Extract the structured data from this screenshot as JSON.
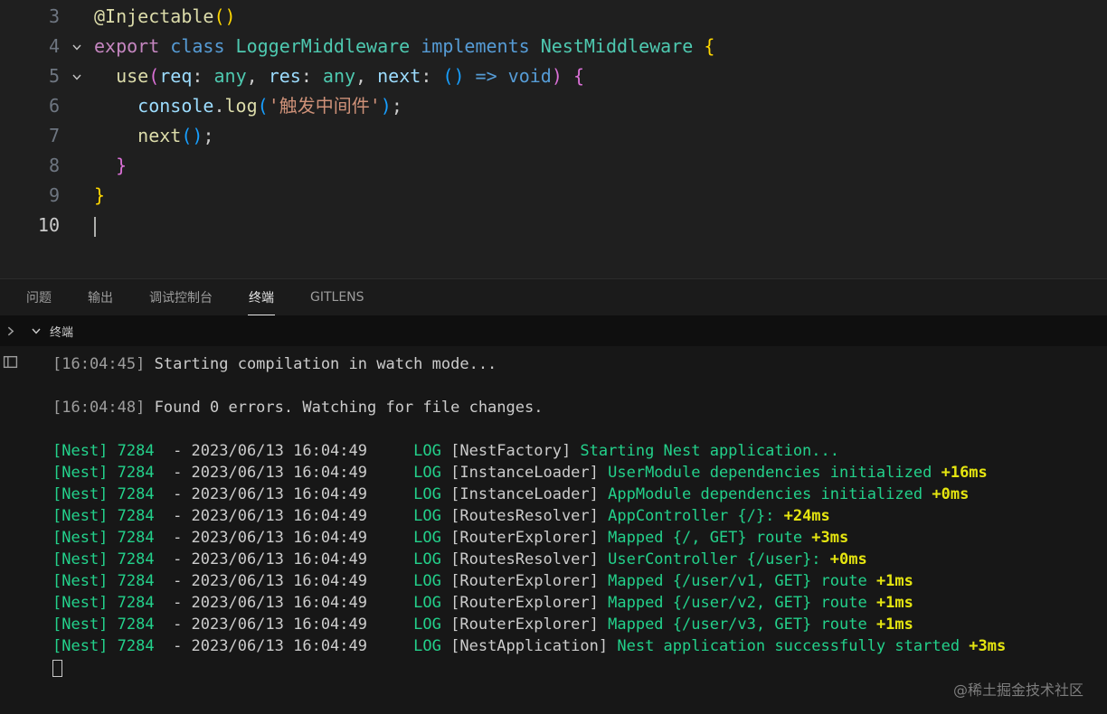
{
  "palette": {
    "fg": "#cccccc",
    "lineNumber": "#6e7681",
    "kwPurple": "#c586c0",
    "kwBlue": "#569cd6",
    "type": "#4ec9b0",
    "func": "#dcdcaa",
    "variable": "#9cdcfe",
    "string": "#ce9178",
    "br1": "#ffd700",
    "br2": "#da70d6",
    "br3": "#179fff",
    "tGreen": "#23d18b",
    "tYellow": "#e5e510",
    "tFg": "#cccccc",
    "tDim": "#9d9d9d"
  },
  "editor": {
    "lines": [
      {
        "num": "3",
        "fold": false,
        "segments": [
          [
            "@Injectable",
            "func"
          ],
          [
            "()",
            "br1"
          ]
        ]
      },
      {
        "num": "4",
        "fold": true,
        "segments": [
          [
            "export ",
            "kwPurple"
          ],
          [
            "class ",
            "kwBlue"
          ],
          [
            "LoggerMiddleware ",
            "type"
          ],
          [
            "implements ",
            "kwBlue"
          ],
          [
            "NestMiddleware ",
            "type"
          ],
          [
            "{",
            "br1"
          ]
        ]
      },
      {
        "num": "5",
        "fold": true,
        "segments": [
          [
            "  ",
            "fg"
          ],
          [
            "use",
            "func"
          ],
          [
            "(",
            "br2"
          ],
          [
            "req",
            "variable"
          ],
          [
            ": ",
            "fg"
          ],
          [
            "any",
            "type"
          ],
          [
            ", ",
            "fg"
          ],
          [
            "res",
            "variable"
          ],
          [
            ": ",
            "fg"
          ],
          [
            "any",
            "type"
          ],
          [
            ", ",
            "fg"
          ],
          [
            "next",
            "variable"
          ],
          [
            ": ",
            "fg"
          ],
          [
            "()",
            "br3"
          ],
          [
            " ",
            "fg"
          ],
          [
            "=> ",
            "kwBlue"
          ],
          [
            "void",
            "kwBlue"
          ],
          [
            ")",
            "br2"
          ],
          [
            " ",
            "fg"
          ],
          [
            "{",
            "br2"
          ]
        ]
      },
      {
        "num": "6",
        "fold": false,
        "segments": [
          [
            "    ",
            "fg"
          ],
          [
            "console",
            "variable"
          ],
          [
            ".",
            "fg"
          ],
          [
            "log",
            "func"
          ],
          [
            "(",
            "br3"
          ],
          [
            "'触发中间件'",
            "string"
          ],
          [
            ")",
            "br3"
          ],
          [
            ";",
            "fg"
          ]
        ]
      },
      {
        "num": "7",
        "fold": false,
        "segments": [
          [
            "    ",
            "fg"
          ],
          [
            "next",
            "func"
          ],
          [
            "()",
            "br3"
          ],
          [
            ";",
            "fg"
          ]
        ]
      },
      {
        "num": "8",
        "fold": false,
        "segments": [
          [
            "  ",
            "fg"
          ],
          [
            "}",
            "br2"
          ]
        ]
      },
      {
        "num": "9",
        "fold": false,
        "segments": [
          [
            "}",
            "br1"
          ]
        ]
      },
      {
        "num": "10",
        "active": true,
        "cursor": true,
        "segments": []
      }
    ]
  },
  "panel": {
    "tabs": [
      {
        "id": "problems",
        "label": "问题",
        "active": false
      },
      {
        "id": "output",
        "label": "输出",
        "active": false
      },
      {
        "id": "debug-console",
        "label": "调试控制台",
        "active": false
      },
      {
        "id": "terminal",
        "label": "终端",
        "active": true
      },
      {
        "id": "gitlens",
        "label": "GITLENS",
        "active": false
      }
    ],
    "section_label": "终端"
  },
  "terminal": {
    "lines": [
      [
        [
          "[16:04:45]",
          "tDim"
        ],
        [
          " Starting compilation in watch mode...",
          "tFg"
        ]
      ],
      [],
      [
        [
          "[16:04:48]",
          "tDim"
        ],
        [
          " Found 0 errors. Watching for file changes.",
          "tFg"
        ]
      ],
      [],
      [
        [
          "[Nest] 7284",
          "tGreen"
        ],
        [
          "  - 2023/06/13 16:04:49     ",
          "tFg"
        ],
        [
          "LOG",
          "tGreen"
        ],
        [
          " [NestFactory] ",
          "tFg"
        ],
        [
          "Starting Nest application...",
          "tGreen"
        ]
      ],
      [
        [
          "[Nest] 7284",
          "tGreen"
        ],
        [
          "  - 2023/06/13 16:04:49     ",
          "tFg"
        ],
        [
          "LOG",
          "tGreen"
        ],
        [
          " [InstanceLoader] ",
          "tFg"
        ],
        [
          "UserModule dependencies initialized",
          "tGreen"
        ],
        [
          " +16ms",
          "tYellow",
          1
        ]
      ],
      [
        [
          "[Nest] 7284",
          "tGreen"
        ],
        [
          "  - 2023/06/13 16:04:49     ",
          "tFg"
        ],
        [
          "LOG",
          "tGreen"
        ],
        [
          " [InstanceLoader] ",
          "tFg"
        ],
        [
          "AppModule dependencies initialized",
          "tGreen"
        ],
        [
          " +0ms",
          "tYellow",
          1
        ]
      ],
      [
        [
          "[Nest] 7284",
          "tGreen"
        ],
        [
          "  - 2023/06/13 16:04:49     ",
          "tFg"
        ],
        [
          "LOG",
          "tGreen"
        ],
        [
          " [RoutesResolver] ",
          "tFg"
        ],
        [
          "AppController {/}:",
          "tGreen"
        ],
        [
          " +24ms",
          "tYellow",
          1
        ]
      ],
      [
        [
          "[Nest] 7284",
          "tGreen"
        ],
        [
          "  - 2023/06/13 16:04:49     ",
          "tFg"
        ],
        [
          "LOG",
          "tGreen"
        ],
        [
          " [RouterExplorer] ",
          "tFg"
        ],
        [
          "Mapped {/, GET} route",
          "tGreen"
        ],
        [
          " +3ms",
          "tYellow",
          1
        ]
      ],
      [
        [
          "[Nest] 7284",
          "tGreen"
        ],
        [
          "  - 2023/06/13 16:04:49     ",
          "tFg"
        ],
        [
          "LOG",
          "tGreen"
        ],
        [
          " [RoutesResolver] ",
          "tFg"
        ],
        [
          "UserController {/user}:",
          "tGreen"
        ],
        [
          " +0ms",
          "tYellow",
          1
        ]
      ],
      [
        [
          "[Nest] 7284",
          "tGreen"
        ],
        [
          "  - 2023/06/13 16:04:49     ",
          "tFg"
        ],
        [
          "LOG",
          "tGreen"
        ],
        [
          " [RouterExplorer] ",
          "tFg"
        ],
        [
          "Mapped {/user/v1, GET} route",
          "tGreen"
        ],
        [
          " +1ms",
          "tYellow",
          1
        ]
      ],
      [
        [
          "[Nest] 7284",
          "tGreen"
        ],
        [
          "  - 2023/06/13 16:04:49     ",
          "tFg"
        ],
        [
          "LOG",
          "tGreen"
        ],
        [
          " [RouterExplorer] ",
          "tFg"
        ],
        [
          "Mapped {/user/v2, GET} route",
          "tGreen"
        ],
        [
          " +1ms",
          "tYellow",
          1
        ]
      ],
      [
        [
          "[Nest] 7284",
          "tGreen"
        ],
        [
          "  - 2023/06/13 16:04:49     ",
          "tFg"
        ],
        [
          "LOG",
          "tGreen"
        ],
        [
          " [RouterExplorer] ",
          "tFg"
        ],
        [
          "Mapped {/user/v3, GET} route",
          "tGreen"
        ],
        [
          " +1ms",
          "tYellow",
          1
        ]
      ],
      [
        [
          "[Nest] 7284",
          "tGreen"
        ],
        [
          "  - 2023/06/13 16:04:49     ",
          "tFg"
        ],
        [
          "LOG",
          "tGreen"
        ],
        [
          " [NestApplication] ",
          "tFg"
        ],
        [
          "Nest application successfully started",
          "tGreen"
        ],
        [
          " +3ms",
          "tYellow",
          1
        ]
      ]
    ],
    "cursor_line": true
  },
  "watermark": "@稀土掘金技术社区"
}
